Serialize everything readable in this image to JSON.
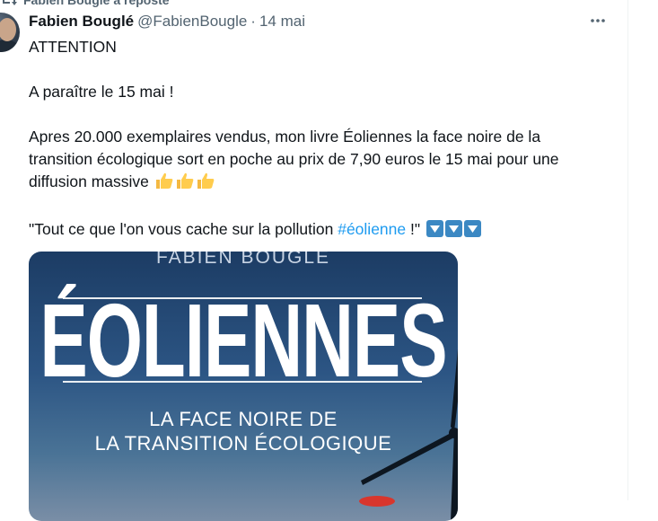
{
  "repost": {
    "label": "Fabien Bouglé a reposté",
    "icon": "repost-icon"
  },
  "tweet": {
    "author_name": "Fabien Bouglé",
    "handle": "@FabienBougle",
    "separator": "·",
    "date": "14 mai",
    "lines": {
      "p1": "ATTENTION",
      "p2": "A paraître le 15 mai !",
      "p3a": "Apres 20.000 exemplaires vendus,  mon livre Éoliennes la face noire de la",
      "p3b": "transition écologique sort en poche au prix de 7,90 euros le 15 mai pour une",
      "p3c": "diffusion massive",
      "p4_prefix": "\"Tout ce que l'on vous cache sur la pollution ",
      "hashtag": "#éolienne",
      "p4_suffix": " !\""
    },
    "emojis": {
      "thumbs": [
        "thumbs-up",
        "thumbs-up",
        "thumbs-up"
      ],
      "arrows": [
        "down-arrow-button",
        "down-arrow-button",
        "down-arrow-button"
      ]
    },
    "more_icon": "more-options-icon"
  },
  "book_cover": {
    "author": "FABIEN BOUGLÉ",
    "title": "ÉOLIENNES",
    "subtitle_1": "LA FACE NOIRE DE",
    "subtitle_2": "LA TRANSITION ÉCOLOGIQUE",
    "colors": {
      "sky_top": "#1c3c64",
      "sky_bottom": "#7a8ea6"
    }
  },
  "colors": {
    "text": "#0f1419",
    "secondary": "#536471",
    "link": "#1d9bf0",
    "emoji_button": "#3b88c3"
  }
}
